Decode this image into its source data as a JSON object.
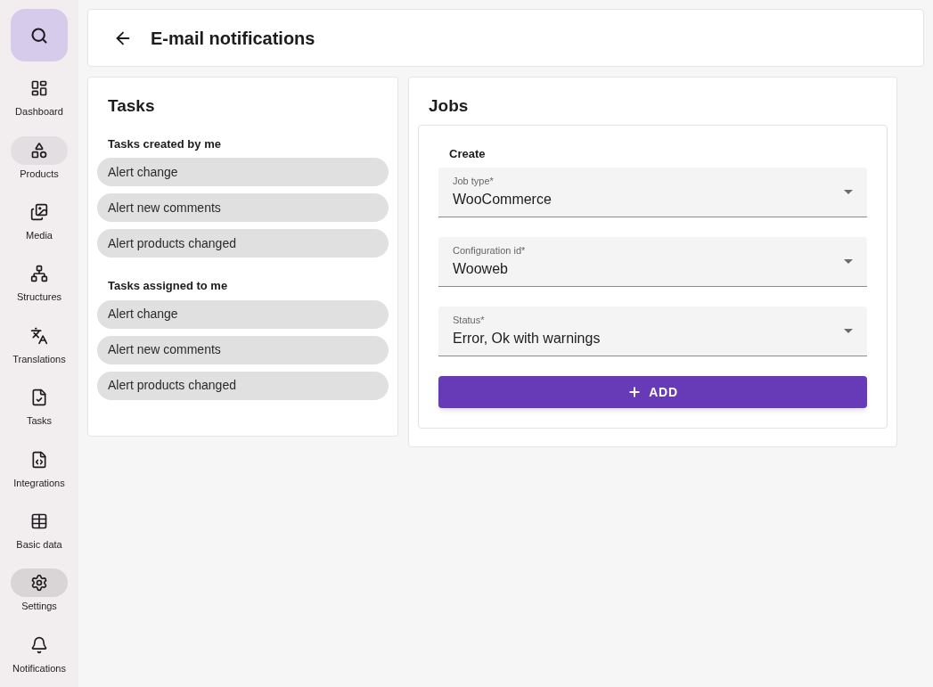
{
  "sidebar": {
    "search_selected": true,
    "items": [
      {
        "label": "Dashboard",
        "selected": false,
        "hovered": false
      },
      {
        "label": "Products",
        "selected": false,
        "hovered": true
      },
      {
        "label": "Media",
        "selected": false,
        "hovered": false
      },
      {
        "label": "Structures",
        "selected": false,
        "hovered": false
      },
      {
        "label": "Translations",
        "selected": false,
        "hovered": false
      },
      {
        "label": "Tasks",
        "selected": false,
        "hovered": false
      },
      {
        "label": "Integrations",
        "selected": false,
        "hovered": false
      },
      {
        "label": "Basic data",
        "selected": false,
        "hovered": false
      },
      {
        "label": "Settings",
        "selected": true,
        "hovered": false
      },
      {
        "label": "Notifications",
        "selected": false,
        "hovered": false
      }
    ]
  },
  "header": {
    "title": "E-mail notifications"
  },
  "tasks": {
    "title": "Tasks",
    "groups": [
      {
        "title": "Tasks created by me",
        "items": [
          "Alert change",
          "Alert new comments",
          "Alert products changed"
        ]
      },
      {
        "title": "Tasks assigned to me",
        "items": [
          "Alert change",
          "Alert new comments",
          "Alert products changed"
        ]
      }
    ]
  },
  "jobs": {
    "title": "Jobs",
    "create": {
      "title": "Create",
      "fields": [
        {
          "label": "Job type",
          "required_mark": "*",
          "value": "WooCommerce"
        },
        {
          "label": "Configuration id",
          "required_mark": "*",
          "value": "Wooweb"
        },
        {
          "label": "Status",
          "required_mark": "*",
          "value": "Error, Ok with warnings"
        }
      ],
      "button": "ADD"
    }
  }
}
